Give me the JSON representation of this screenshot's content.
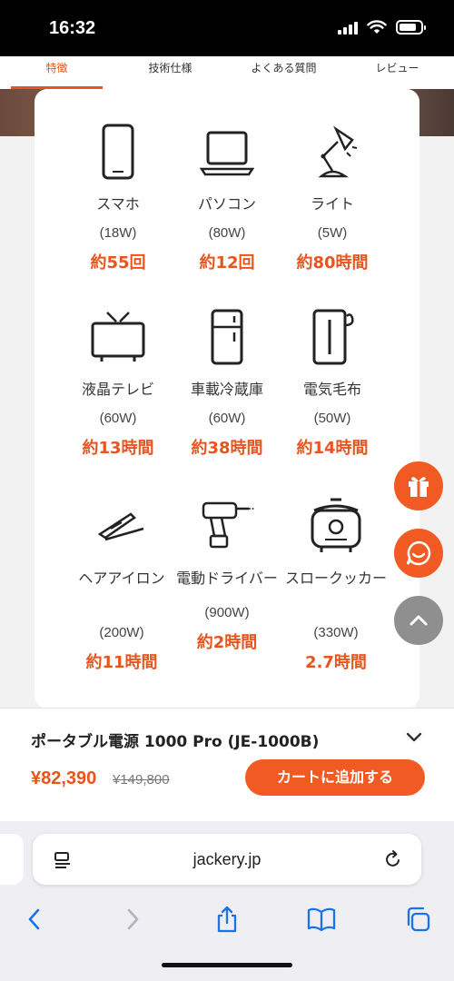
{
  "status": {
    "time": "16:32"
  },
  "tabs": [
    {
      "label": "特徴",
      "active": true
    },
    {
      "label": "技術仕様",
      "active": false
    },
    {
      "label": "よくある質問",
      "active": false
    },
    {
      "label": "レビュー",
      "active": false
    }
  ],
  "devices": [
    {
      "icon": "smartphone-icon",
      "name": "スマホ",
      "power": "(18W)",
      "usage": "約55回"
    },
    {
      "icon": "laptop-icon",
      "name": "パソコン",
      "power": "(80W)",
      "usage": "約12回"
    },
    {
      "icon": "desk-lamp-icon",
      "name": "ライト",
      "power": "(5W)",
      "usage": "約80時間"
    },
    {
      "icon": "tv-icon",
      "name": "液晶テレビ",
      "power": "(60W)",
      "usage": "約13時間"
    },
    {
      "icon": "car-fridge-icon",
      "name": "車載冷蔵庫",
      "power": "(60W)",
      "usage": "約38時間"
    },
    {
      "icon": "electric-blanket-icon",
      "name": "電気毛布",
      "power": "(50W)",
      "usage": "約14時間"
    },
    {
      "icon": "hair-iron-icon",
      "name": "ヘアアイロン",
      "power": "(200W)",
      "usage": "約11時間"
    },
    {
      "icon": "power-drill-icon",
      "name": "電動ドライバー",
      "power": "(900W)",
      "usage": "約2時間"
    },
    {
      "icon": "slow-cooker-icon",
      "name": "スロークッカー",
      "power": "(330W)",
      "usage": "2.7時間"
    }
  ],
  "product": {
    "title": "ポータブル電源 1000 Pro (JE-1000B)",
    "price": "¥82,390",
    "old_price": "¥149,800",
    "cart_label": "カートに追加する"
  },
  "browser": {
    "url": "jackery.jp"
  },
  "colors": {
    "accent": "#e8541c",
    "fab_orange": "#f15a22",
    "fab_gray": "#8f8f8f"
  }
}
